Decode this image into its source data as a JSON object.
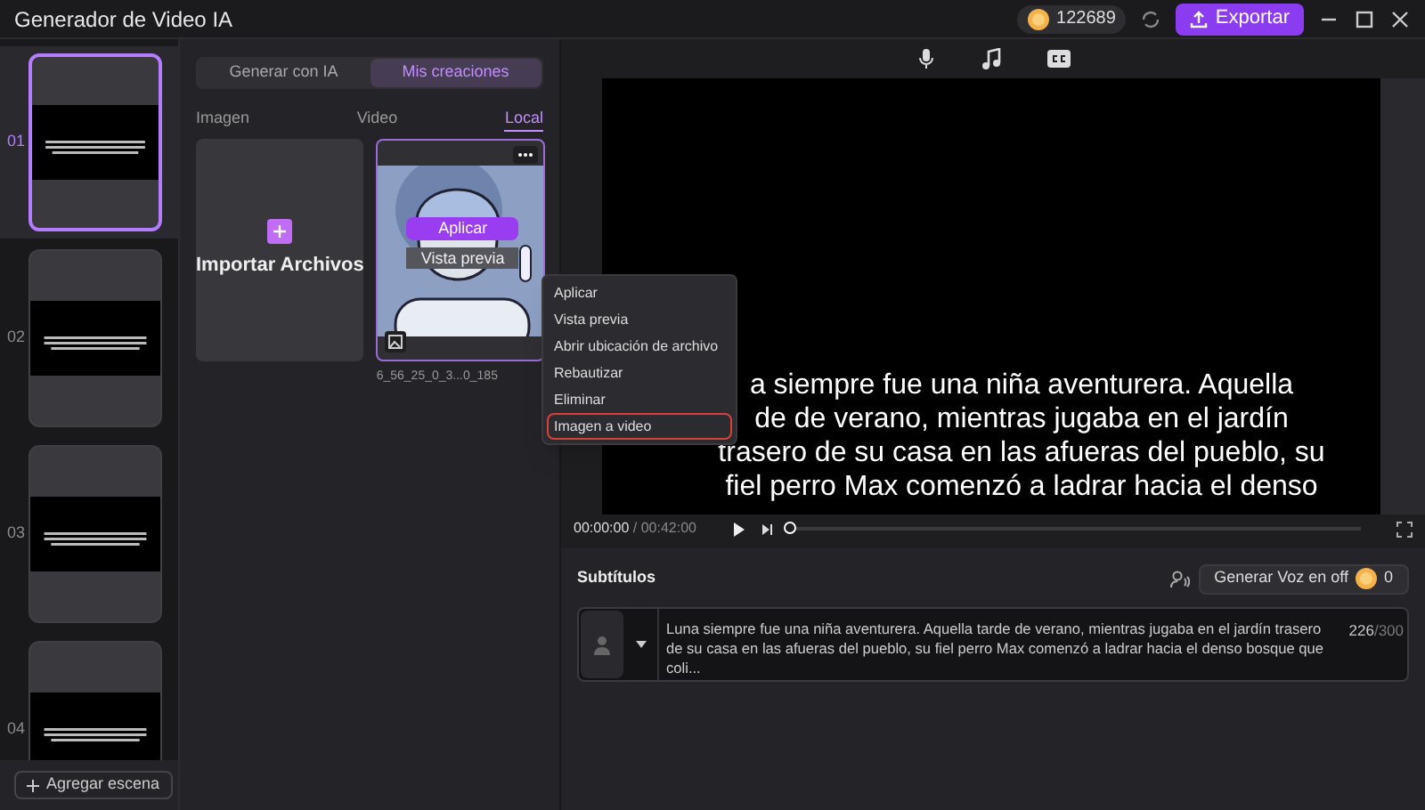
{
  "window": {
    "title": "Generador de Video IA",
    "credits": "122689",
    "export_button": "Exportar"
  },
  "scenes": [
    {
      "number": "01",
      "selected": true
    },
    {
      "number": "02",
      "selected": false
    },
    {
      "number": "03",
      "selected": false
    },
    {
      "number": "04",
      "selected": false
    }
  ],
  "add_scene_button": "Agregar escena",
  "mode_tabs": [
    {
      "label": "Generar con IA",
      "selected": false
    },
    {
      "label": "Mis creaciones",
      "selected": true
    }
  ],
  "media_tabs": [
    {
      "label": "Imagen",
      "selected": false
    },
    {
      "label": "Video",
      "selected": false
    },
    {
      "label": "Local",
      "selected": true
    }
  ],
  "import_card": {
    "label": "Importar Archivos"
  },
  "media_item": {
    "kind": "picture",
    "apply_button": "Aplicar",
    "preview_button": "Vista previa",
    "filename": "6_56_25_0_3...0_185"
  },
  "context_menu": [
    {
      "label": "Aplicar",
      "highlighted": false
    },
    {
      "label": "Vista previa",
      "highlighted": false
    },
    {
      "label": "Abrir ubicación de archivo",
      "highlighted": false
    },
    {
      "label": "Rebautizar",
      "highlighted": false
    },
    {
      "label": "Eliminar",
      "highlighted": false
    },
    {
      "label": "Imagen a video",
      "highlighted": true
    }
  ],
  "preview": {
    "caption_lines": [
      "a siempre fue una niña aventurera. Aquella",
      "de de verano, mientras jugaba en el jardín",
      "trasero de su casa en las afueras del pueblo, su",
      "fiel perro Max comenzó a ladrar hacia el denso"
    ],
    "current_time": "00:00:00",
    "total_time": "/ 00:42:00",
    "level": 0
  },
  "subtitles": {
    "title": "Subtítulos",
    "voice_button": "Generar Voz en off",
    "voice_cost": "0",
    "items": [
      {
        "text": "Luna siempre fue una niña aventurera. Aquella tarde de verano, mientras jugaba en el jardín trasero de su casa en las afueras del pueblo, su fiel perro Max comenzó a ladrar hacia el denso bosque que coli...",
        "count": "226",
        "limit": "/300"
      }
    ]
  }
}
